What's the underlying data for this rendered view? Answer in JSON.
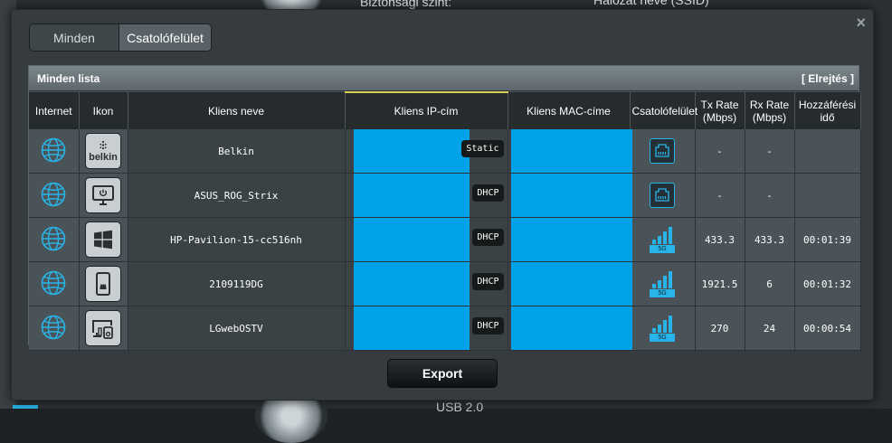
{
  "background": {
    "security_label": "Biztonsági szint:",
    "ssid_label": "Hálózat neve (SSID)",
    "usb_label": "USB 2.0"
  },
  "modal": {
    "close_glyph": "×",
    "tabs": [
      {
        "label": "Minden",
        "active": false
      },
      {
        "label": "Csatolófelület",
        "active": true
      }
    ],
    "list_title": "Minden lista",
    "hide_label": "[ Elrejtés ]",
    "columns": [
      "Internet",
      "Ikon",
      "Kliens neve",
      "Kliens IP-cím",
      "Kliens MAC-címe",
      "Csatolófelület",
      "Tx Rate (Mbps)",
      "Rx Rate (Mbps)",
      "Hozzáférési idő"
    ],
    "export_label": "Export"
  },
  "clients": [
    {
      "name": "Belkin",
      "ip_type": "Static",
      "icon": "belkin-logo-icon",
      "interface": "ethernet",
      "tx": "-",
      "rx": "-",
      "time": ""
    },
    {
      "name": "ASUS_ROG_Strix",
      "ip_type": "DHCP",
      "icon": "desktop-icon",
      "interface": "ethernet",
      "tx": "-",
      "rx": "-",
      "time": ""
    },
    {
      "name": "HP-Pavilion-15-cc516nh",
      "ip_type": "DHCP",
      "icon": "windows-icon",
      "interface": "wifi-5g",
      "tx": "433.3",
      "rx": "433.3",
      "time": "00:01:39"
    },
    {
      "name": "2109119DG",
      "ip_type": "DHCP",
      "icon": "android-phone-icon",
      "interface": "wifi-5g",
      "tx": "1921.5",
      "rx": "6",
      "time": "00:01:32"
    },
    {
      "name": "LGwebOSTV",
      "ip_type": "DHCP",
      "icon": "tv-device-icon",
      "interface": "wifi-5g",
      "tx": "270",
      "rx": "24",
      "time": "00:00:54"
    }
  ],
  "band_label": "5G",
  "belkin_text": "belkin",
  "colors": {
    "accent_blue": "#29b4e9",
    "mask_blue": "#00a2e8",
    "sorted_marker": "#d9d052"
  }
}
